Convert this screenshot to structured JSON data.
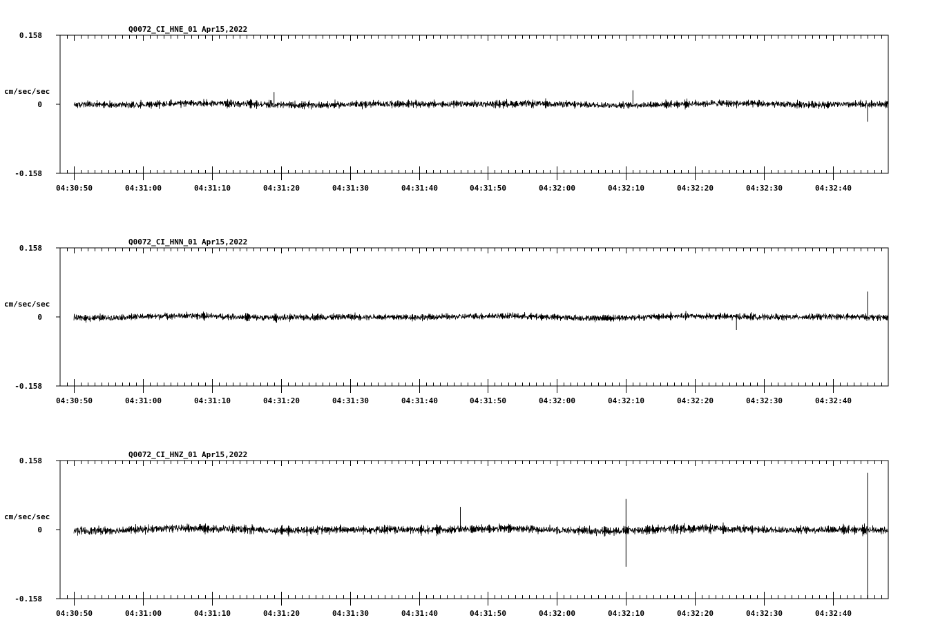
{
  "colors": {
    "background": "#ffffff",
    "trace": "#000000",
    "axis": "#000000"
  },
  "chart_data": [
    {
      "type": "line",
      "title": "Q0072_CI_HNE_01  Apr15,2022",
      "ylabel": "cm/sec/sec",
      "yticks": [
        "0.158",
        "0",
        "-0.158"
      ],
      "ylim": [
        -0.158,
        0.158
      ],
      "xticks": [
        "04:30:50",
        "04:31:00",
        "04:31:10",
        "04:31:20",
        "04:31:30",
        "04:31:40",
        "04:31:50",
        "04:32:00",
        "04:32:10",
        "04:32:20",
        "04:32:30",
        "04:32:40"
      ],
      "x_range": [
        "04:30:48",
        "04:32:48"
      ],
      "signal": {
        "start": "04:30:50",
        "amplitude": 0.012,
        "drift": 0.006,
        "peaks": [
          {
            "t": "04:31:19",
            "v": 0.028
          },
          {
            "t": "04:32:11",
            "v": 0.032
          },
          {
            "t": "04:32:45",
            "v": -0.04
          }
        ]
      }
    },
    {
      "type": "line",
      "title": "Q0072_CI_HNN_01  Apr15,2022",
      "ylabel": "cm/sec/sec",
      "yticks": [
        "0.158",
        "0",
        "-0.158"
      ],
      "ylim": [
        -0.158,
        0.158
      ],
      "xticks": [
        "04:30:50",
        "04:31:00",
        "04:31:10",
        "04:31:20",
        "04:31:30",
        "04:31:40",
        "04:31:50",
        "04:32:00",
        "04:32:10",
        "04:32:20",
        "04:32:30",
        "04:32:40"
      ],
      "x_range": [
        "04:30:48",
        "04:32:48"
      ],
      "signal": {
        "start": "04:30:50",
        "amplitude": 0.011,
        "drift": 0.007,
        "peaks": [
          {
            "t": "04:32:45",
            "v": 0.058
          },
          {
            "t": "04:32:26",
            "v": -0.03
          }
        ]
      }
    },
    {
      "type": "line",
      "title": "Q0072_CI_HNZ_01  Apr15,2022",
      "ylabel": "cm/sec/sec",
      "yticks": [
        "0.158",
        "0",
        "-0.158"
      ],
      "ylim": [
        -0.158,
        0.158
      ],
      "xticks": [
        "04:30:50",
        "04:31:00",
        "04:31:10",
        "04:31:20",
        "04:31:30",
        "04:31:40",
        "04:31:50",
        "04:32:00",
        "04:32:10",
        "04:32:20",
        "04:32:30",
        "04:32:40"
      ],
      "x_range": [
        "04:30:48",
        "04:32:48"
      ],
      "signal": {
        "start": "04:30:50",
        "amplitude": 0.014,
        "drift": 0.008,
        "peaks": [
          {
            "t": "04:32:10",
            "v": 0.07
          },
          {
            "t": "04:32:10",
            "v": -0.085
          },
          {
            "t": "04:32:45",
            "v": 0.13
          },
          {
            "t": "04:32:45",
            "v": -0.158
          },
          {
            "t": "04:31:46",
            "v": 0.052
          }
        ]
      }
    }
  ]
}
